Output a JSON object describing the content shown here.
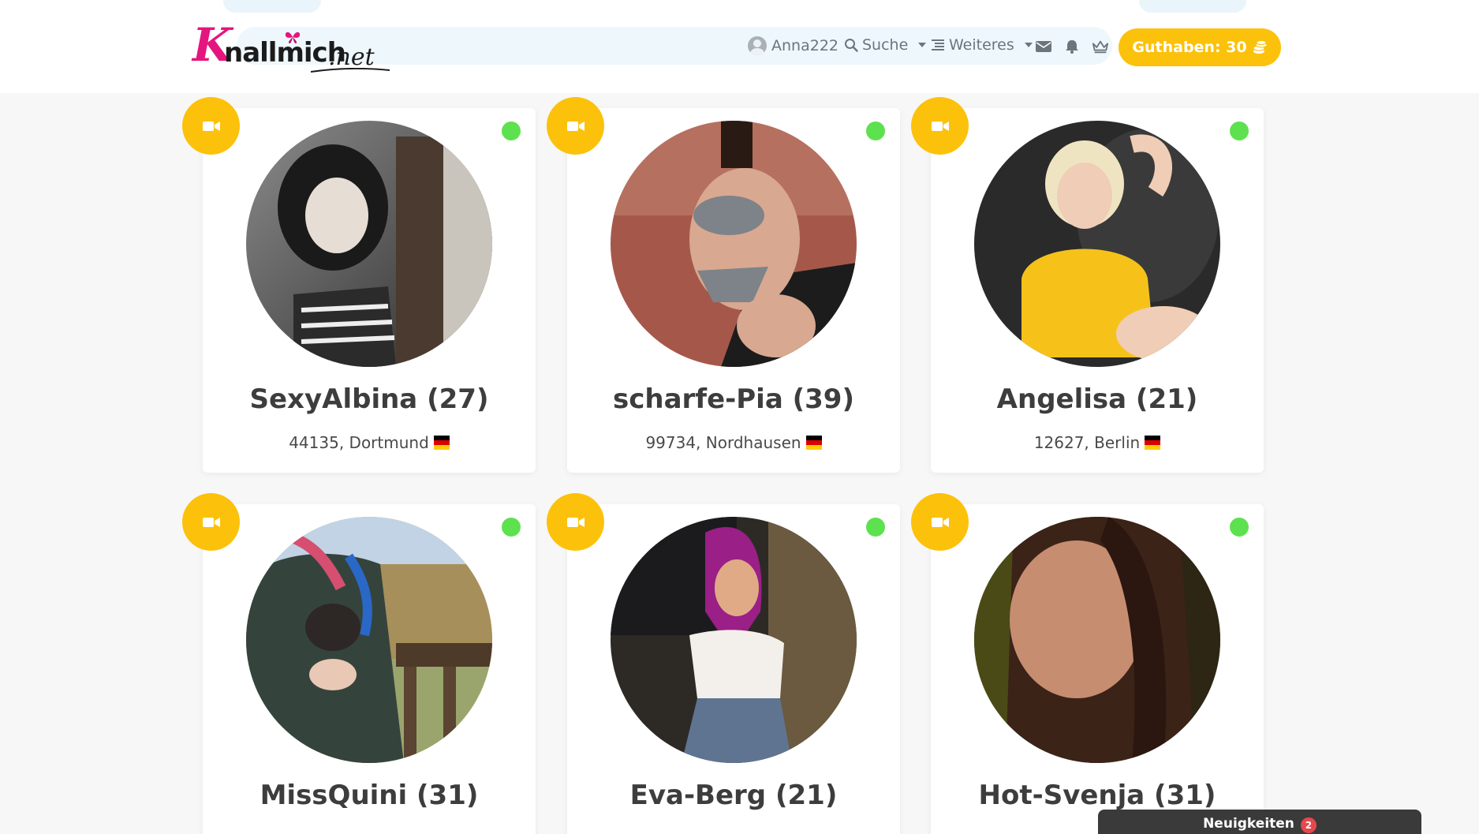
{
  "header": {
    "logo_text": "Knallmich.net",
    "user": {
      "name": "Anna222"
    },
    "nav": [
      {
        "label": "Suche"
      },
      {
        "label": "Weiteres"
      }
    ],
    "credit_label": "Guthaben: 30"
  },
  "profiles": [
    {
      "name": "SexyAlbina (27)",
      "location": "44135, Dortmund",
      "online": true,
      "cam": true
    },
    {
      "name": "scharfe-Pia (39)",
      "location": "99734, Nordhausen",
      "online": true,
      "cam": true
    },
    {
      "name": "Angelisa (21)",
      "location": "12627, Berlin",
      "online": true,
      "cam": true
    },
    {
      "name": "MissQuini (31)",
      "online": true,
      "cam": true
    },
    {
      "name": "Eva-Berg (21)",
      "online": true,
      "cam": true
    },
    {
      "name": "Hot-Svenja (31)",
      "online": true,
      "cam": true
    }
  ],
  "news": {
    "label": "Neuigkeiten",
    "count": "2"
  },
  "colors": {
    "accent": "#fcc10a",
    "online": "#5ee14e",
    "brand_pink": "#e4157f"
  }
}
